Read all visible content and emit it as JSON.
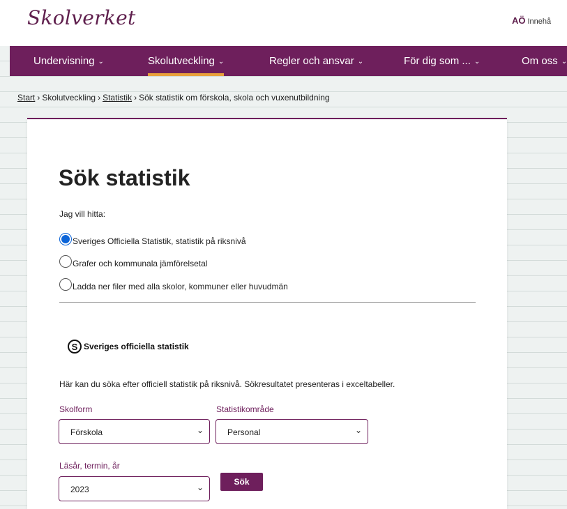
{
  "header": {
    "logo": "Skolverket",
    "lang_glyph": "AÖ",
    "lang_text": "Innehå"
  },
  "nav": {
    "items": [
      {
        "label": "Undervisning",
        "active": false
      },
      {
        "label": "Skolutveckling",
        "active": true
      },
      {
        "label": "Regler och ansvar",
        "active": false
      },
      {
        "label": "För dig som ...",
        "active": false
      },
      {
        "label": "Om oss",
        "active": false
      }
    ],
    "chevron": "⌄",
    "active_color": "#e8a13b",
    "bg_color": "#6e1f5c"
  },
  "breadcrumb": {
    "items": [
      "Start",
      "Skolutveckling",
      "Statistik",
      "Sök statistik om förskola, skola och vuxenutbildning"
    ],
    "separator": "›"
  },
  "main": {
    "title": "Sök statistik",
    "intro": "Jag vill hitta:",
    "options": [
      {
        "label": "Sveriges Officiella Statistik, statistik på riksnivå",
        "checked": true
      },
      {
        "label": "Grafer och kommunala jämförelsetal",
        "checked": false
      },
      {
        "label": "Ladda ner filer med alla skolor, kommuner eller huvudmän",
        "checked": false
      }
    ],
    "sos_logo_letter": "S",
    "sos_logo_text": "Sveriges officiella statistik",
    "description": "Här kan du söka efter officiell statistik på riksnivå. Sökresultatet presenteras i exceltabeller.",
    "fields": {
      "skolform": {
        "label": "Skolform",
        "value": "Förskola"
      },
      "statistikomrade": {
        "label": "Statistikområde",
        "value": "Personal"
      },
      "lasar": {
        "label": "Läsår, termin, år",
        "value": "2023"
      }
    },
    "search_button": "Sök",
    "caret": "⌄"
  }
}
